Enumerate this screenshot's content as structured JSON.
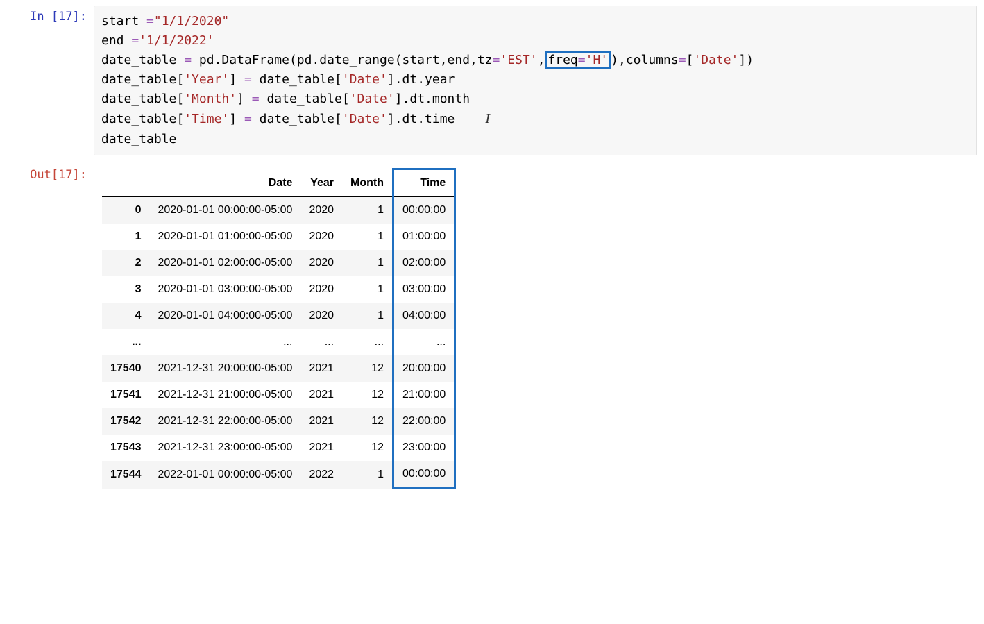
{
  "prompt_in": "In [17]:",
  "prompt_out": "Out[17]:",
  "code": {
    "line1_a": "start ",
    "line1_eq": "=",
    "line1_str": "\"1/1/2020\"",
    "line2_a": "end ",
    "line2_eq": "=",
    "line2_str": "'1/1/2022'",
    "line3_a": "date_table ",
    "line3_eq": "=",
    "line3_b": " pd.DataFrame(pd.date_range(start,end,tz",
    "line3_eq2": "=",
    "line3_str1": "'EST'",
    "line3_c": ",",
    "line3_hl_a": "freq",
    "line3_hl_eq": "=",
    "line3_hl_str": "'H'",
    "line3_d": "),columns",
    "line3_eq3": "=",
    "line3_e": "[",
    "line3_str2": "'Date'",
    "line3_f": "])",
    "line4_a": "date_table[",
    "line4_str": "'Year'",
    "line4_b": "] ",
    "line4_eq": "=",
    "line4_c": " date_table[",
    "line4_str2": "'Date'",
    "line4_d": "].dt.year",
    "line5_a": "date_table[",
    "line5_str": "'Month'",
    "line5_b": "] ",
    "line5_eq": "=",
    "line5_c": " date_table[",
    "line5_str2": "'Date'",
    "line5_d": "].dt.month",
    "line6_a": "date_table[",
    "line6_str": "'Time'",
    "line6_b": "] ",
    "line6_eq": "=",
    "line6_c": " date_table[",
    "line6_str2": "'Date'",
    "line6_d": "].dt.time",
    "line7": "date_table",
    "cursor": "I"
  },
  "table": {
    "headers": {
      "c0": "",
      "c1": "Date",
      "c2": "Year",
      "c3": "Month",
      "c4": "Time"
    },
    "rows": [
      {
        "idx": "0",
        "date": "2020-01-01 00:00:00-05:00",
        "year": "2020",
        "month": "1",
        "time": "00:00:00"
      },
      {
        "idx": "1",
        "date": "2020-01-01 01:00:00-05:00",
        "year": "2020",
        "month": "1",
        "time": "01:00:00"
      },
      {
        "idx": "2",
        "date": "2020-01-01 02:00:00-05:00",
        "year": "2020",
        "month": "1",
        "time": "02:00:00"
      },
      {
        "idx": "3",
        "date": "2020-01-01 03:00:00-05:00",
        "year": "2020",
        "month": "1",
        "time": "03:00:00"
      },
      {
        "idx": "4",
        "date": "2020-01-01 04:00:00-05:00",
        "year": "2020",
        "month": "1",
        "time": "04:00:00"
      },
      {
        "idx": "...",
        "date": "...",
        "year": "...",
        "month": "...",
        "time": "...",
        "ellipsis": true
      },
      {
        "idx": "17540",
        "date": "2021-12-31 20:00:00-05:00",
        "year": "2021",
        "month": "12",
        "time": "20:00:00"
      },
      {
        "idx": "17541",
        "date": "2021-12-31 21:00:00-05:00",
        "year": "2021",
        "month": "12",
        "time": "21:00:00"
      },
      {
        "idx": "17542",
        "date": "2021-12-31 22:00:00-05:00",
        "year": "2021",
        "month": "12",
        "time": "22:00:00"
      },
      {
        "idx": "17543",
        "date": "2021-12-31 23:00:00-05:00",
        "year": "2021",
        "month": "12",
        "time": "23:00:00"
      },
      {
        "idx": "17544",
        "date": "2022-01-01 00:00:00-05:00",
        "year": "2022",
        "month": "1",
        "time": "00:00:00"
      }
    ]
  }
}
